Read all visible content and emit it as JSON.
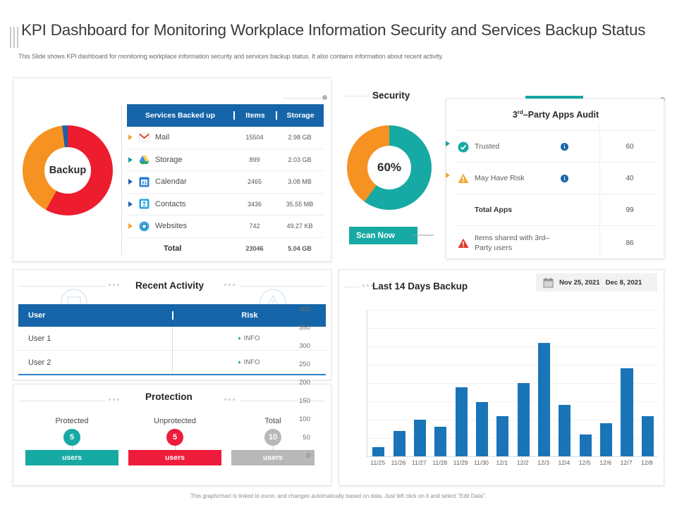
{
  "header": {
    "title": "KPI Dashboard for Monitoring  Workplace Information Security and Services Backup Status",
    "subtitle": "This Slide shows KPI dashboard for monitoring workplace information security and services backup status. It also contains information about recent activity."
  },
  "backup": {
    "donut_center_label": "Backup",
    "donut_segments": [
      {
        "name": "red",
        "color": "#ED1C2E",
        "percent": 58
      },
      {
        "name": "orange",
        "color": "#F59222",
        "percent": 40
      },
      {
        "name": "blue",
        "color": "#1F5FA9",
        "percent": 2
      }
    ],
    "table": {
      "columns": [
        "Services Backed up",
        "Items",
        "Storage"
      ],
      "rows": [
        {
          "icon": "gmail-icon",
          "marker_color": "#F0A33C",
          "service": "Mail",
          "items": "15504",
          "storage": "2.98 GB"
        },
        {
          "icon": "drive-icon",
          "marker_color": "#1A9C9C",
          "service": "Storage",
          "items": "899",
          "storage": "2.03 GB"
        },
        {
          "icon": "calendar-icon",
          "marker_color": "#1F5FA9",
          "service": "Calendar",
          "items": "2465",
          "storage": "3.08 MB"
        },
        {
          "icon": "contacts-icon",
          "marker_color": "#1F5FA9",
          "service": "Contacts",
          "items": "3436",
          "storage": "35.55 MB"
        },
        {
          "icon": "sites-icon",
          "marker_color": "#F0A33C",
          "service": "Websites",
          "items": "742",
          "storage": "49.27 KB"
        }
      ],
      "total": {
        "label": "Total",
        "items": "23046",
        "storage": "5.04 GB"
      }
    }
  },
  "security": {
    "section_title": "Security",
    "donut_center_label": "60%",
    "donut_segments": [
      {
        "name": "teal",
        "color": "#17A9A3",
        "percent": 60
      },
      {
        "name": "orange",
        "color": "#F59222",
        "percent": 40
      }
    ],
    "scan_button_label": "Scan Now"
  },
  "apps_audit": {
    "title_pre": "3",
    "title_sup": "rd",
    "title_post": "–Party Apps  Audit",
    "accent_color": "#17A9A3",
    "rows": [
      {
        "icon": "check-circle-icon",
        "label": "Trusted",
        "info": "i",
        "value": "60",
        "bold": false
      },
      {
        "icon": "warning-triangle-icon",
        "label": "May Have Risk",
        "info": "i",
        "value": "40",
        "bold": false
      },
      {
        "icon": "none",
        "label": "Total Apps",
        "info": "",
        "value": "99",
        "bold": true
      },
      {
        "icon": "alert-triangle-red-icon",
        "label": "Items shared with 3rd–\nParty users",
        "info": "",
        "value": "86",
        "bold": false
      }
    ]
  },
  "recent_activity": {
    "section_title": "Recent Activity",
    "columns": [
      "User",
      "Risk"
    ],
    "rows": [
      {
        "user": "User 1",
        "risk": "INFO"
      },
      {
        "user": "User 2",
        "risk": "INFO"
      }
    ]
  },
  "protection": {
    "section_title": "Protection",
    "items": [
      {
        "label": "Protected",
        "value": "5",
        "unit": "users",
        "color": "#17A9A3"
      },
      {
        "label": "Unprotected",
        "value": "5",
        "unit": "users",
        "color": "#ED1C3A"
      },
      {
        "label": "Total",
        "value": "10",
        "unit": "users",
        "color": "#B8B8B8"
      }
    ]
  },
  "chart_data": {
    "type": "bar",
    "title": "Last 14 Days  Backup",
    "xlabel": "",
    "ylabel": "",
    "categories": [
      "11/25",
      "11/26",
      "11/27",
      "11/28",
      "11/29",
      "11/30",
      "12/1",
      "12/2",
      "12/3",
      "12/4",
      "12/5",
      "12/6",
      "12/7",
      "12/8"
    ],
    "values": [
      25,
      70,
      100,
      80,
      188,
      148,
      110,
      200,
      310,
      140,
      60,
      90,
      240,
      110
    ],
    "yticks": [
      0,
      50,
      100,
      150,
      200,
      250,
      300,
      350,
      400
    ],
    "ylim": [
      0,
      400
    ],
    "grid": true,
    "legend": "none",
    "bar_color": "#1A74B8",
    "date_range": {
      "icon": "calendar-icon",
      "start": "Nov 25, 2021",
      "end": "Dec 8, 2021"
    }
  },
  "footer": {
    "note": "This graph/chart is linked to excel, and changes automatically based on data. Just left click on it and select \"Edit Data\"."
  }
}
